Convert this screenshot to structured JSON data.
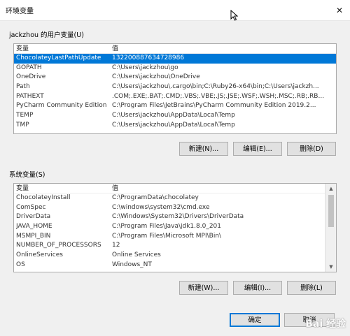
{
  "window": {
    "title": "环境变量"
  },
  "user_section": {
    "label": "jackzhou 的用户变量(U)",
    "columns": [
      "变量",
      "值"
    ],
    "rows": [
      {
        "name": "ChocolateyLastPathUpdate",
        "value": "132200887634728986",
        "selected": true
      },
      {
        "name": "GOPATH",
        "value": "C:\\Users\\jackzhou\\go"
      },
      {
        "name": "OneDrive",
        "value": "C:\\Users\\jackzhou\\OneDrive"
      },
      {
        "name": "Path",
        "value": "C:\\Users\\jackzhou\\.cargo\\bin;C:\\Ruby26-x64\\bin;C:\\Users\\jackzh..."
      },
      {
        "name": "PATHEXT",
        "value": ".COM;.EXE;.BAT;.CMD;.VBS;.VBE;.JS;.JSE;.WSF;.WSH;.MSC;.RB;.RB..."
      },
      {
        "name": "PyCharm Community Edition",
        "value": "C:\\Program Files\\JetBrains\\PyCharm Community Edition 2019.2..."
      },
      {
        "name": "TEMP",
        "value": "C:\\Users\\jackzhou\\AppData\\Local\\Temp"
      },
      {
        "name": "TMP",
        "value": "C:\\Users\\jackzhou\\AppData\\Local\\Temp"
      }
    ],
    "buttons": {
      "new": "新建(N)...",
      "edit": "编辑(E)...",
      "delete": "删除(D)"
    }
  },
  "system_section": {
    "label": "系统变量(S)",
    "columns": [
      "变量",
      "值"
    ],
    "rows": [
      {
        "name": "ChocolateyInstall",
        "value": "C:\\ProgramData\\chocolatey"
      },
      {
        "name": "ComSpec",
        "value": "C:\\windows\\system32\\cmd.exe"
      },
      {
        "name": "DriverData",
        "value": "C:\\Windows\\System32\\Drivers\\DriverData"
      },
      {
        "name": "JAVA_HOME",
        "value": "C:\\Program Files\\Java\\jdk1.8.0_201"
      },
      {
        "name": "MSMPI_BIN",
        "value": "C:\\Program Files\\Microsoft MPI\\Bin\\"
      },
      {
        "name": "NUMBER_OF_PROCESSORS",
        "value": "12"
      },
      {
        "name": "OnlineServices",
        "value": "Online Services"
      },
      {
        "name": "OS",
        "value": "Windows_NT"
      }
    ],
    "buttons": {
      "new": "新建(W)...",
      "edit": "编辑(I)...",
      "delete": "删除(L)"
    }
  },
  "footer": {
    "ok": "确定",
    "cancel": "取消"
  },
  "watermark": "Bai 经验",
  "colors": {
    "selection": "#0078d7",
    "background": "#f0f0f0"
  }
}
